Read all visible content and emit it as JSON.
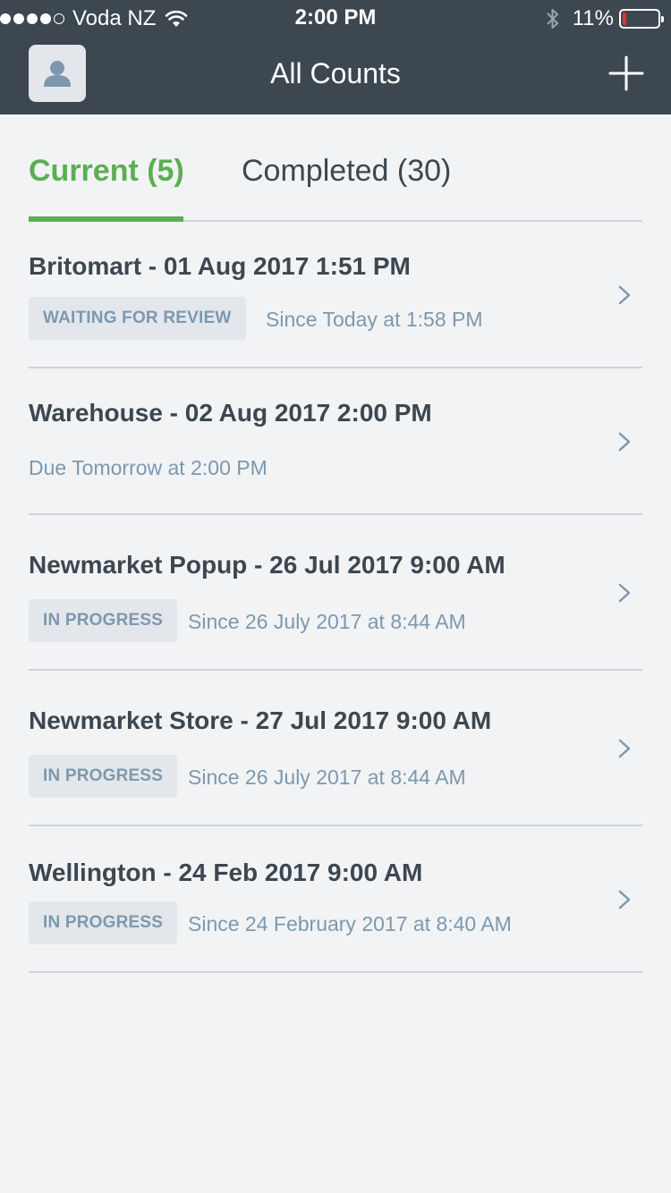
{
  "status_bar": {
    "carrier": "Voda NZ",
    "time": "2:00 PM",
    "battery": "11%",
    "battery_level": 0.11,
    "signal_bars": 4
  },
  "nav": {
    "title": "All Counts",
    "avatar_icon": "user-icon",
    "add_icon": "plus-icon"
  },
  "tabs": {
    "current": "Current (5)",
    "completed": "Completed (30)"
  },
  "counts": [
    {
      "title": "Britomart - 01 Aug 2017 1:51 PM",
      "badge": "WAITING FOR REVIEW",
      "meta": "Since Today at 1:58 PM"
    },
    {
      "title": "Warehouse - 02 Aug 2017 2:00 PM",
      "badge": "",
      "meta": "Due Tomorrow at 2:00 PM"
    },
    {
      "title": "Newmarket Popup - 26 Jul 2017 9:00 AM",
      "badge": "IN PROGRESS",
      "meta": "Since 26 July 2017 at 8:44 AM"
    },
    {
      "title": "Newmarket Store - 27 Jul 2017 9:00 AM",
      "badge": "IN PROGRESS",
      "meta": "Since 26 July 2017 at 8:44 AM"
    },
    {
      "title": "Wellington - 24 Feb 2017 9:00 AM",
      "badge": "IN PROGRESS",
      "meta": "Since 24 February 2017 at 8:40 AM"
    }
  ],
  "colors": {
    "header": "#3c4750",
    "accent": "#5cae53",
    "muted": "#7d98ae",
    "badge_bg": "#e3e7ec",
    "battery_low": "#e2342e"
  }
}
